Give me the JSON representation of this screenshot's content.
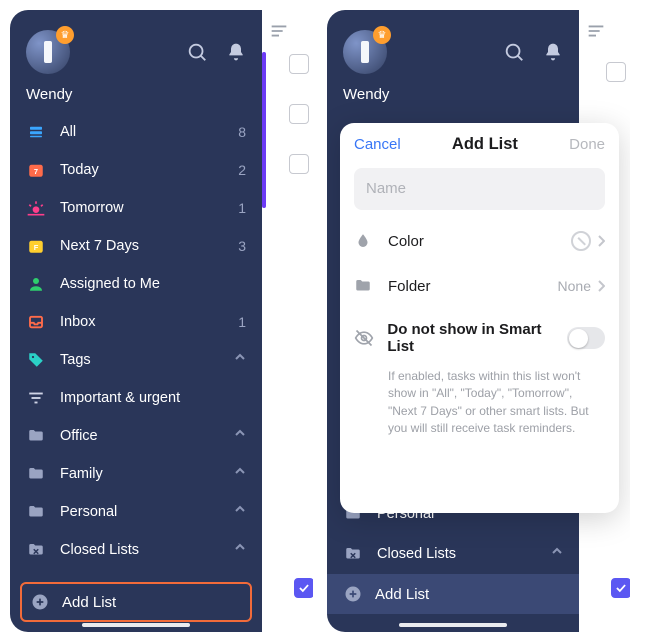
{
  "user": {
    "name": "Wendy"
  },
  "left": {
    "items": [
      {
        "key": "all",
        "label": "All",
        "count": "8",
        "icon": "stack-icon",
        "color": "#3aa6ff"
      },
      {
        "key": "today",
        "label": "Today",
        "count": "2",
        "icon": "calendar-7-icon",
        "color": "#ff6b4a"
      },
      {
        "key": "tomorrow",
        "label": "Tomorrow",
        "count": "1",
        "icon": "sunrise-icon",
        "color": "#ff3e8b"
      },
      {
        "key": "next7",
        "label": "Next 7 Days",
        "count": "3",
        "icon": "calendar-f-icon",
        "color": "#ffcf2e"
      },
      {
        "key": "assigned",
        "label": "Assigned to Me",
        "count": "",
        "icon": "person-icon",
        "color": "#2ecf6d"
      },
      {
        "key": "inbox",
        "label": "Inbox",
        "count": "1",
        "icon": "inbox-icon",
        "color": "#ff6b4a"
      },
      {
        "key": "tags",
        "label": "Tags",
        "count": "",
        "icon": "tag-icon",
        "color": "#2bd1c7",
        "chev": true
      },
      {
        "key": "important",
        "label": "Important & urgent",
        "count": "",
        "icon": "filter-icon",
        "color": "#cfd4e6"
      },
      {
        "key": "office",
        "label": "Office",
        "count": "",
        "icon": "folder-icon",
        "color": "#9aa4c2",
        "chev": true
      },
      {
        "key": "family",
        "label": "Family",
        "count": "",
        "icon": "folder-icon",
        "color": "#9aa4c2",
        "chev": true
      },
      {
        "key": "personal",
        "label": "Personal",
        "count": "",
        "icon": "folder-icon",
        "color": "#9aa4c2",
        "chev": true
      },
      {
        "key": "closed",
        "label": "Closed Lists",
        "count": "",
        "icon": "folder-x-icon",
        "color": "#9aa4c2",
        "chev": true
      }
    ],
    "add_list": "Add List"
  },
  "right": {
    "visible_items": [
      {
        "key": "personal",
        "label": "Personal"
      },
      {
        "key": "closed",
        "label": "Closed Lists",
        "chev": true
      }
    ],
    "add_list": "Add List"
  },
  "modal": {
    "title": "Add List",
    "cancel": "Cancel",
    "done": "Done",
    "name_placeholder": "Name",
    "color_label": "Color",
    "folder_label": "Folder",
    "folder_value": "None",
    "hide_label": "Do not show in Smart List",
    "hint": "If enabled, tasks within this list won't show in \"All\", \"Today\", \"Tomorrow\", \"Next 7 Days\" or other smart lists. But you will still receive task reminders."
  }
}
